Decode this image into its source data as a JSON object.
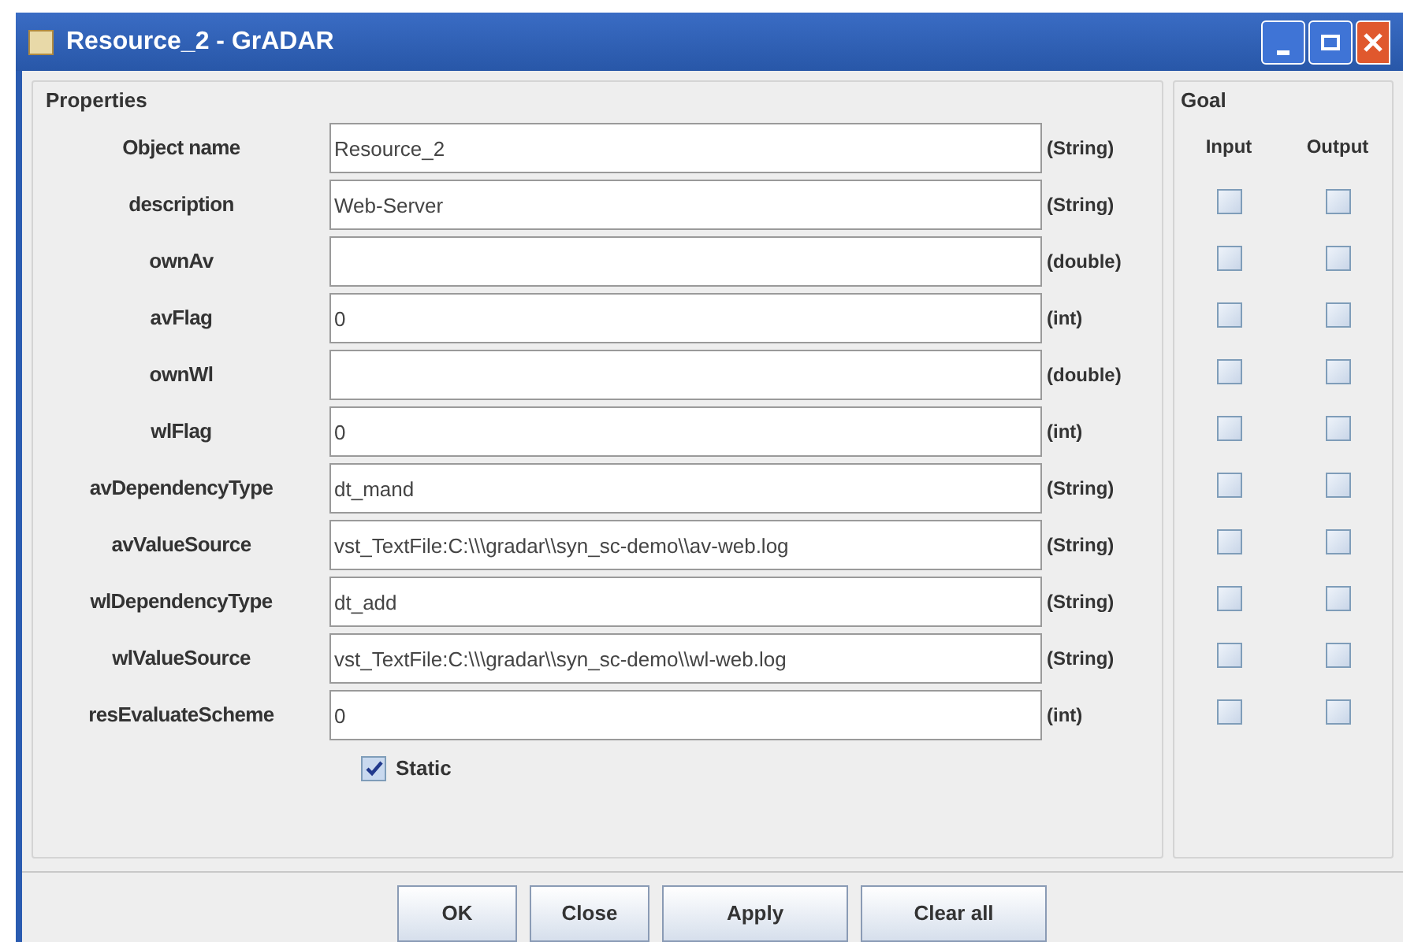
{
  "window": {
    "title": "Resource_2 - GrADAR"
  },
  "properties": {
    "title": "Properties",
    "rows": [
      {
        "label": "Object name",
        "value": "Resource_2",
        "type": "(String)"
      },
      {
        "label": "description",
        "value": "Web-Server",
        "type": "(String)",
        "input": false,
        "output": false
      },
      {
        "label": "ownAv",
        "value": "",
        "type": "(double)",
        "input": false,
        "output": false
      },
      {
        "label": "avFlag",
        "value": "0",
        "type": "(int)",
        "input": false,
        "output": false
      },
      {
        "label": "ownWl",
        "value": "",
        "type": "(double)",
        "input": false,
        "output": false
      },
      {
        "label": "wlFlag",
        "value": "0",
        "type": "(int)",
        "input": false,
        "output": false
      },
      {
        "label": "avDependencyType",
        "value": "dt_mand",
        "type": "(String)",
        "input": false,
        "output": false
      },
      {
        "label": "avValueSource",
        "value": "vst_TextFile:C:\\\\\\gradar\\\\syn_sc-demo\\\\av-web.log",
        "type": "(String)",
        "input": false,
        "output": false
      },
      {
        "label": "wlDependencyType",
        "value": "dt_add",
        "type": "(String)",
        "input": false,
        "output": false
      },
      {
        "label": "wlValueSource",
        "value": "vst_TextFile:C:\\\\\\gradar\\\\syn_sc-demo\\\\wl-web.log",
        "type": "(String)",
        "input": false,
        "output": false
      },
      {
        "label": "resEvaluateScheme",
        "value": "0",
        "type": "(int)",
        "input": false,
        "output": false
      }
    ],
    "static": {
      "label": "Static",
      "checked": true
    }
  },
  "goal": {
    "title": "Goal",
    "columns": [
      "Input",
      "Output"
    ]
  },
  "buttons": [
    "OK",
    "Close",
    "Apply",
    "Clear all"
  ]
}
